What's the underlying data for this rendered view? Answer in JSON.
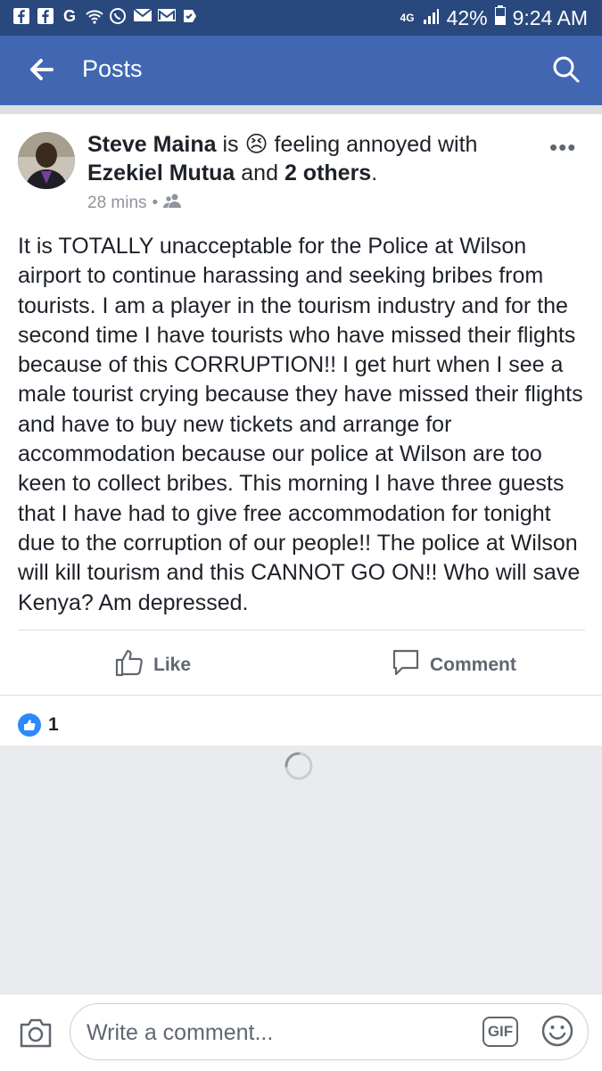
{
  "status_bar": {
    "left_icons": [
      "facebook-icon",
      "facebook-icon",
      "google-icon",
      "wifi-icon",
      "whatsapp-icon",
      "mail-icon",
      "gmail-icon",
      "check-icon"
    ],
    "network": "4G",
    "battery": "42%",
    "time": "9:24 AM"
  },
  "app_bar": {
    "title": "Posts",
    "back_icon": "arrow-left-icon",
    "search_icon": "search-icon",
    "color": "#4267b2"
  },
  "post": {
    "author": "Steve Maina",
    "is_text": "is",
    "feeling_emoji": "😣",
    "feeling_text": "feeling annoyed with",
    "tagged": "Ezekiel Mutua",
    "and_text": "and",
    "others": "2 others",
    "period": ".",
    "time": "28 mins",
    "dot": "•",
    "audience_icon": "friends-icon",
    "more_label": "•••",
    "body": "It is TOTALLY unacceptable for the Police at Wilson airport to continue harassing and seeking bribes from tourists. I am a player in the tourism industry and for the second time I have tourists who have missed their flights because of this CORRUPTION!! I get hurt when I see a male tourist crying because they have missed their flights and have to buy new tickets and arrange for accommodation because our police at Wilson are too keen to collect bribes. This morning I have three guests that I have had to give free accommodation for tonight due to the corruption of our people!! The police at Wilson will kill tourism and this CANNOT GO ON!! Who will save Kenya? Am depressed."
  },
  "actions": {
    "like_label": "Like",
    "comment_label": "Comment"
  },
  "reactions": {
    "count": "1",
    "icon": "like-reaction-icon",
    "color": "#2d88ff"
  },
  "composer": {
    "placeholder": "Write a comment...",
    "gif_label": "GIF",
    "camera_icon": "camera-icon",
    "emoji_icon": "smiley-icon"
  }
}
